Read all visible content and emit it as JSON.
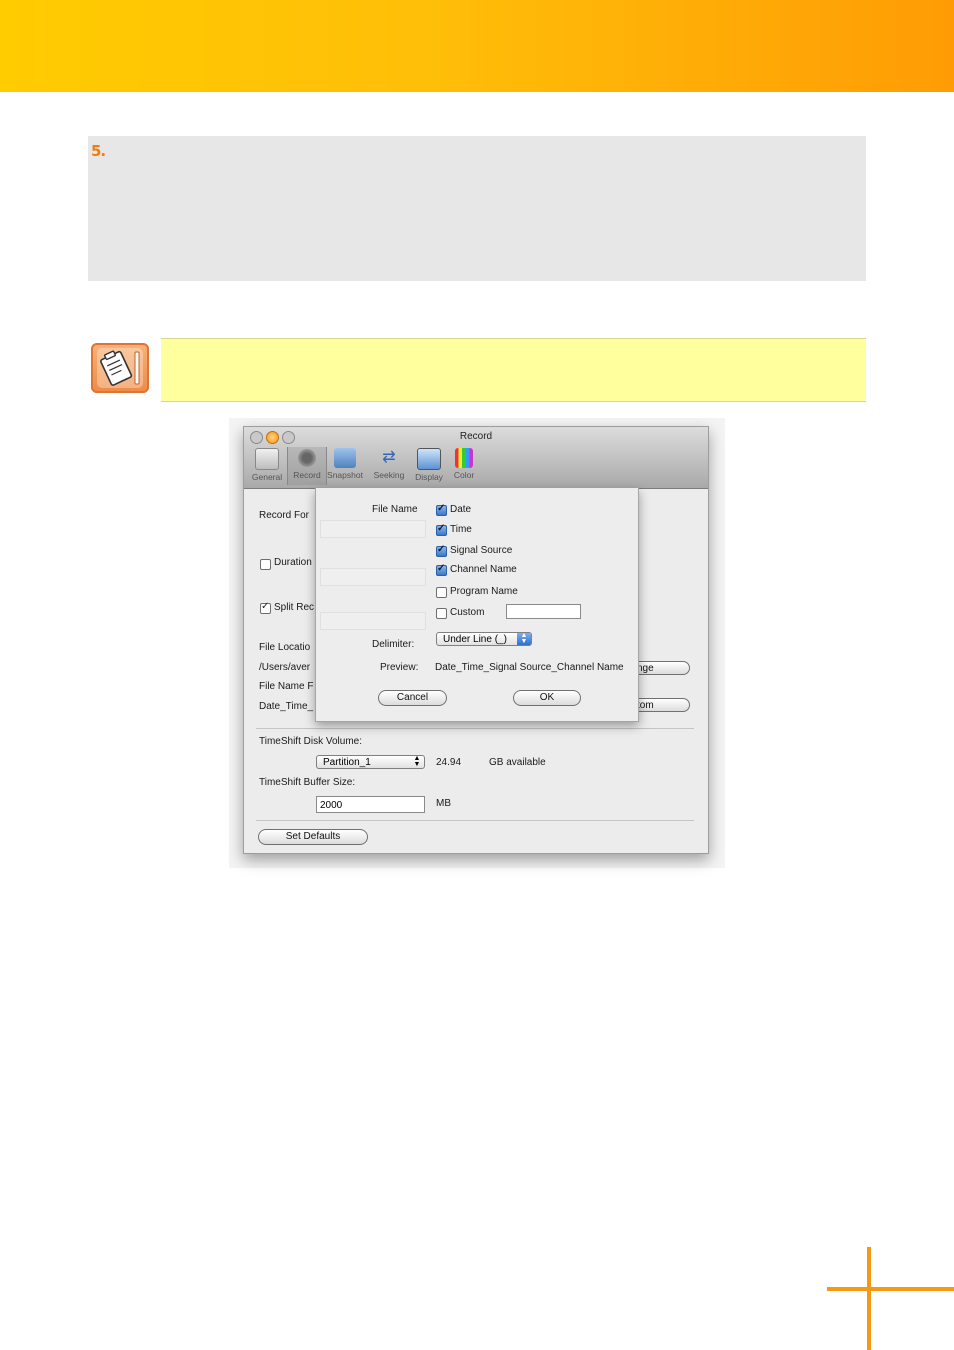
{
  "step": {
    "number": "5."
  },
  "icons": {
    "note": "note-clipboard-icon"
  },
  "colors": {
    "header_start": "#ffcc00",
    "header_end": "#ff9c05",
    "accent": "#f39a12",
    "note_bg": "#ffff9d"
  },
  "window": {
    "title": "Record",
    "toolbar": [
      {
        "label": "General",
        "icon": "general-icon"
      },
      {
        "label": "Record",
        "icon": "record-icon"
      },
      {
        "label": "Snapshot",
        "icon": "snapshot-icon"
      },
      {
        "label": "Seeking",
        "icon": "seeking-icon"
      },
      {
        "label": "Display",
        "icon": "display-icon"
      },
      {
        "label": "Color",
        "icon": "color-icon"
      }
    ],
    "background": {
      "record_format": "Record For",
      "duration": "Duration",
      "split": "Split Rec",
      "file_location": "File Locatio",
      "path": "/Users/aver",
      "file_name_format": "File Name F",
      "format_value": "Date_Time_",
      "change_btn": "nge",
      "custom_btn": "tom",
      "timeshift_volume_label": "TimeShift Disk Volume:",
      "partition": "Partition_1",
      "available_num": "24.94",
      "available_txt": "GB available",
      "buffer_label": "TimeShift Buffer Size:",
      "buffer_value": "2000",
      "buffer_unit": "MB",
      "set_defaults": "Set Defaults"
    },
    "sheet": {
      "file_name_label": "File Name",
      "options": [
        {
          "label": "Date",
          "checked": true
        },
        {
          "label": "Time",
          "checked": true
        },
        {
          "label": "Signal Source",
          "checked": true
        },
        {
          "label": "Channel Name",
          "checked": true
        },
        {
          "label": "Program Name",
          "checked": false
        },
        {
          "label": "Custom",
          "checked": false
        }
      ],
      "custom_value": "",
      "delimiter_label": "Delimiter:",
      "delimiter_value": "Under Line (_)",
      "preview_label": "Preview:",
      "preview_value": "Date_Time_Signal Source_Channel Name",
      "cancel": "Cancel",
      "ok": "OK"
    }
  }
}
